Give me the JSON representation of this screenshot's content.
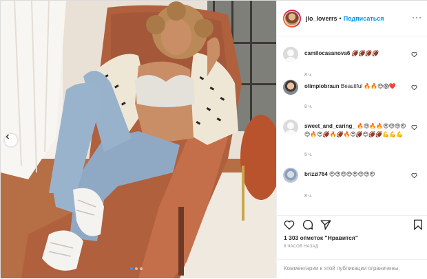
{
  "header": {
    "username": "jlo_loverrs",
    "separator": "•",
    "follow_label": "Подписаться",
    "more_label": "···"
  },
  "comments": [
    {
      "username": "camilocasanova6",
      "text": "🏈🏈🏈🏈",
      "time": "8 ч.",
      "avatar": "blank"
    },
    {
      "username": "olimpiobraun",
      "text": "Beautiful 🔥🔥😍😱❤️",
      "time": "8 ч.",
      "avatar": "photo"
    },
    {
      "username": "sweet_and_caring_",
      "text": "🔥😍🔥🔥😍😍😍😍😍🔥😍🏈🔥🏈🔥😍🏈😍🏈🏈💪💪💪",
      "time": "5 ч.",
      "avatar": "blank"
    },
    {
      "username": "brizzi764",
      "text": "😍😍😍😍😍😍😍😍",
      "time": "8 ч.",
      "avatar": "photo"
    }
  ],
  "actions": {
    "likes": "1 303 отметок \"Нравится\"",
    "posted": "8 ЧАСОВ НАЗАД",
    "comments_limited": "Комментарии к этой публикации ограничены."
  },
  "carousel": {
    "count": 3,
    "active_index": 0
  },
  "colors": {
    "link": "#0095f6",
    "secondary_text": "#8e8e8e",
    "active_dot": "#3897f0",
    "border": "#dbdbdb"
  },
  "icons": [
    "left-arrow-icon",
    "more-icon",
    "heart-icon",
    "comment-icon",
    "share-icon",
    "bookmark-icon"
  ]
}
